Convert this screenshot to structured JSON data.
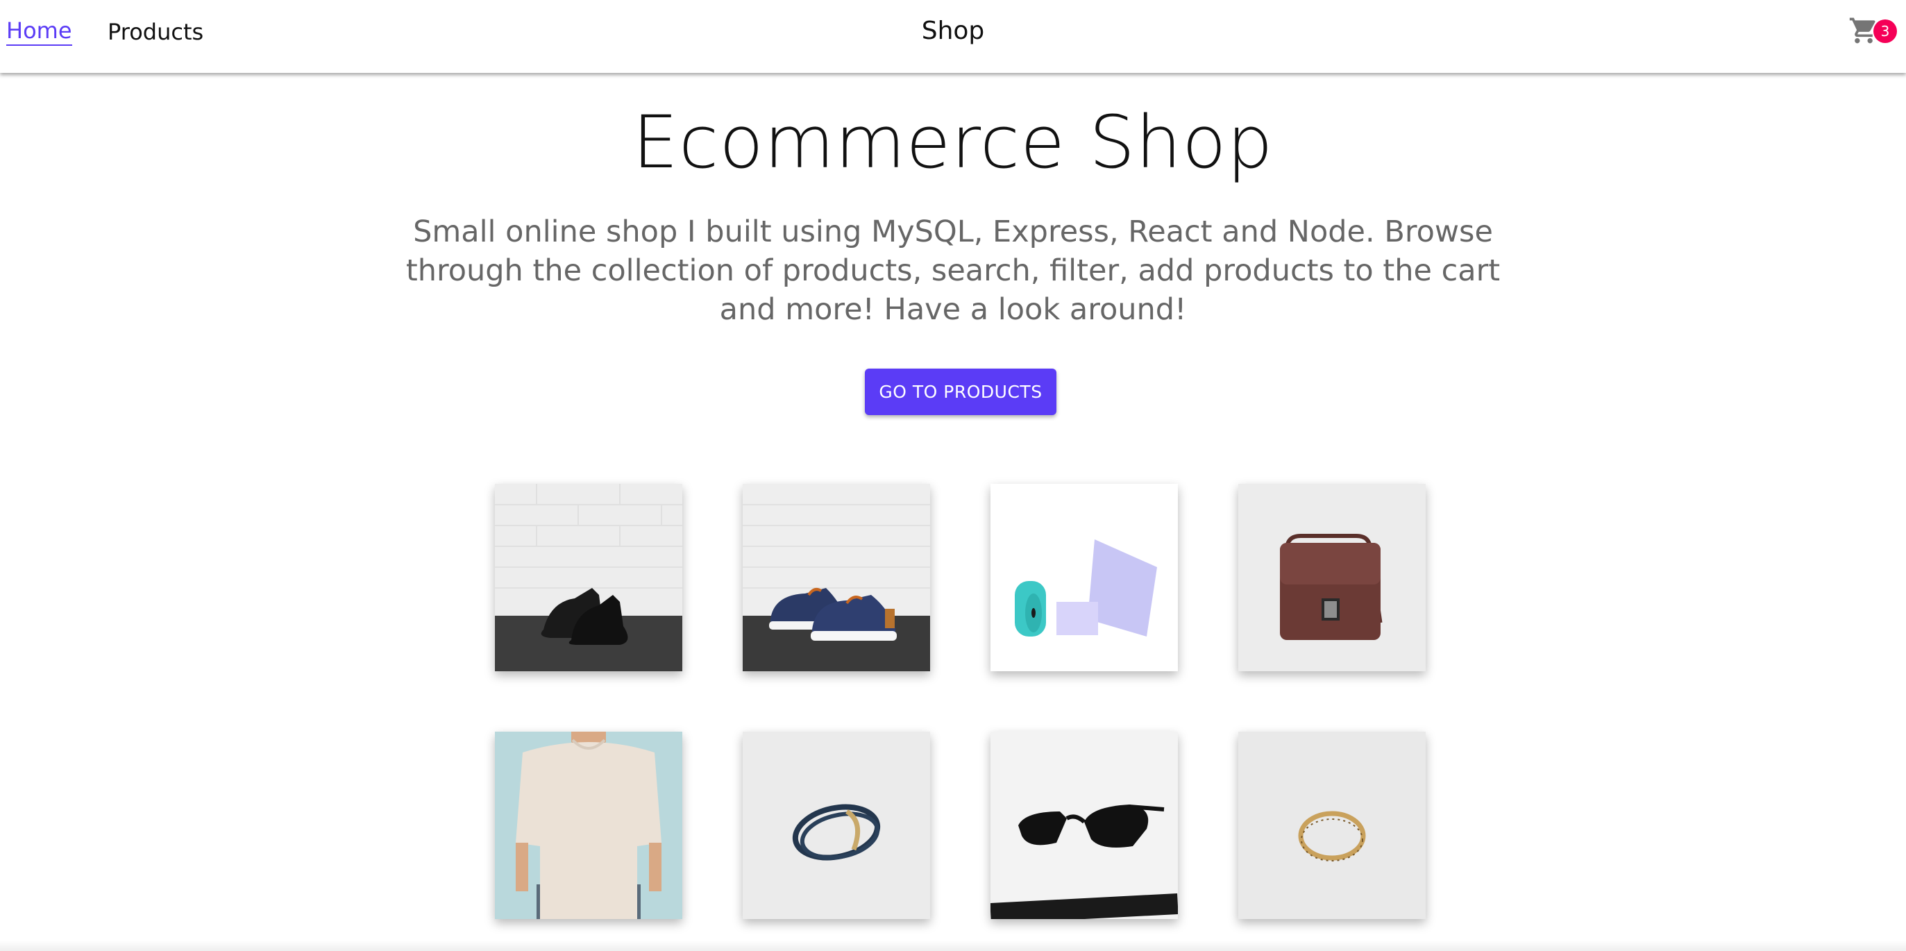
{
  "nav": {
    "home_label": "Home",
    "products_label": "Products",
    "brand": "Shop",
    "cart_count": "3",
    "accent_color": "#5b3cf6",
    "badge_color": "#f50057",
    "cart_icon": "shopping-cart-icon"
  },
  "hero": {
    "title": "Ecommerce Shop",
    "subtitle": "Small online shop I built using MySQL, Express, React and Node. Browse through the collection of products, search, filter, add products to the cart and more! Have a look around!",
    "cta_label": "GO TO PRODUCTS",
    "cta_color": "#5b3cf6"
  },
  "products": [
    {
      "image": "black-sneakers-image"
    },
    {
      "image": "navy-sneakers-image"
    },
    {
      "image": "yoga-mat-blocks-image"
    },
    {
      "image": "brown-bag-image"
    },
    {
      "image": "tshirt-image"
    },
    {
      "image": "bracelet-image"
    },
    {
      "image": "sunglasses-image"
    },
    {
      "image": "ring-image"
    }
  ]
}
